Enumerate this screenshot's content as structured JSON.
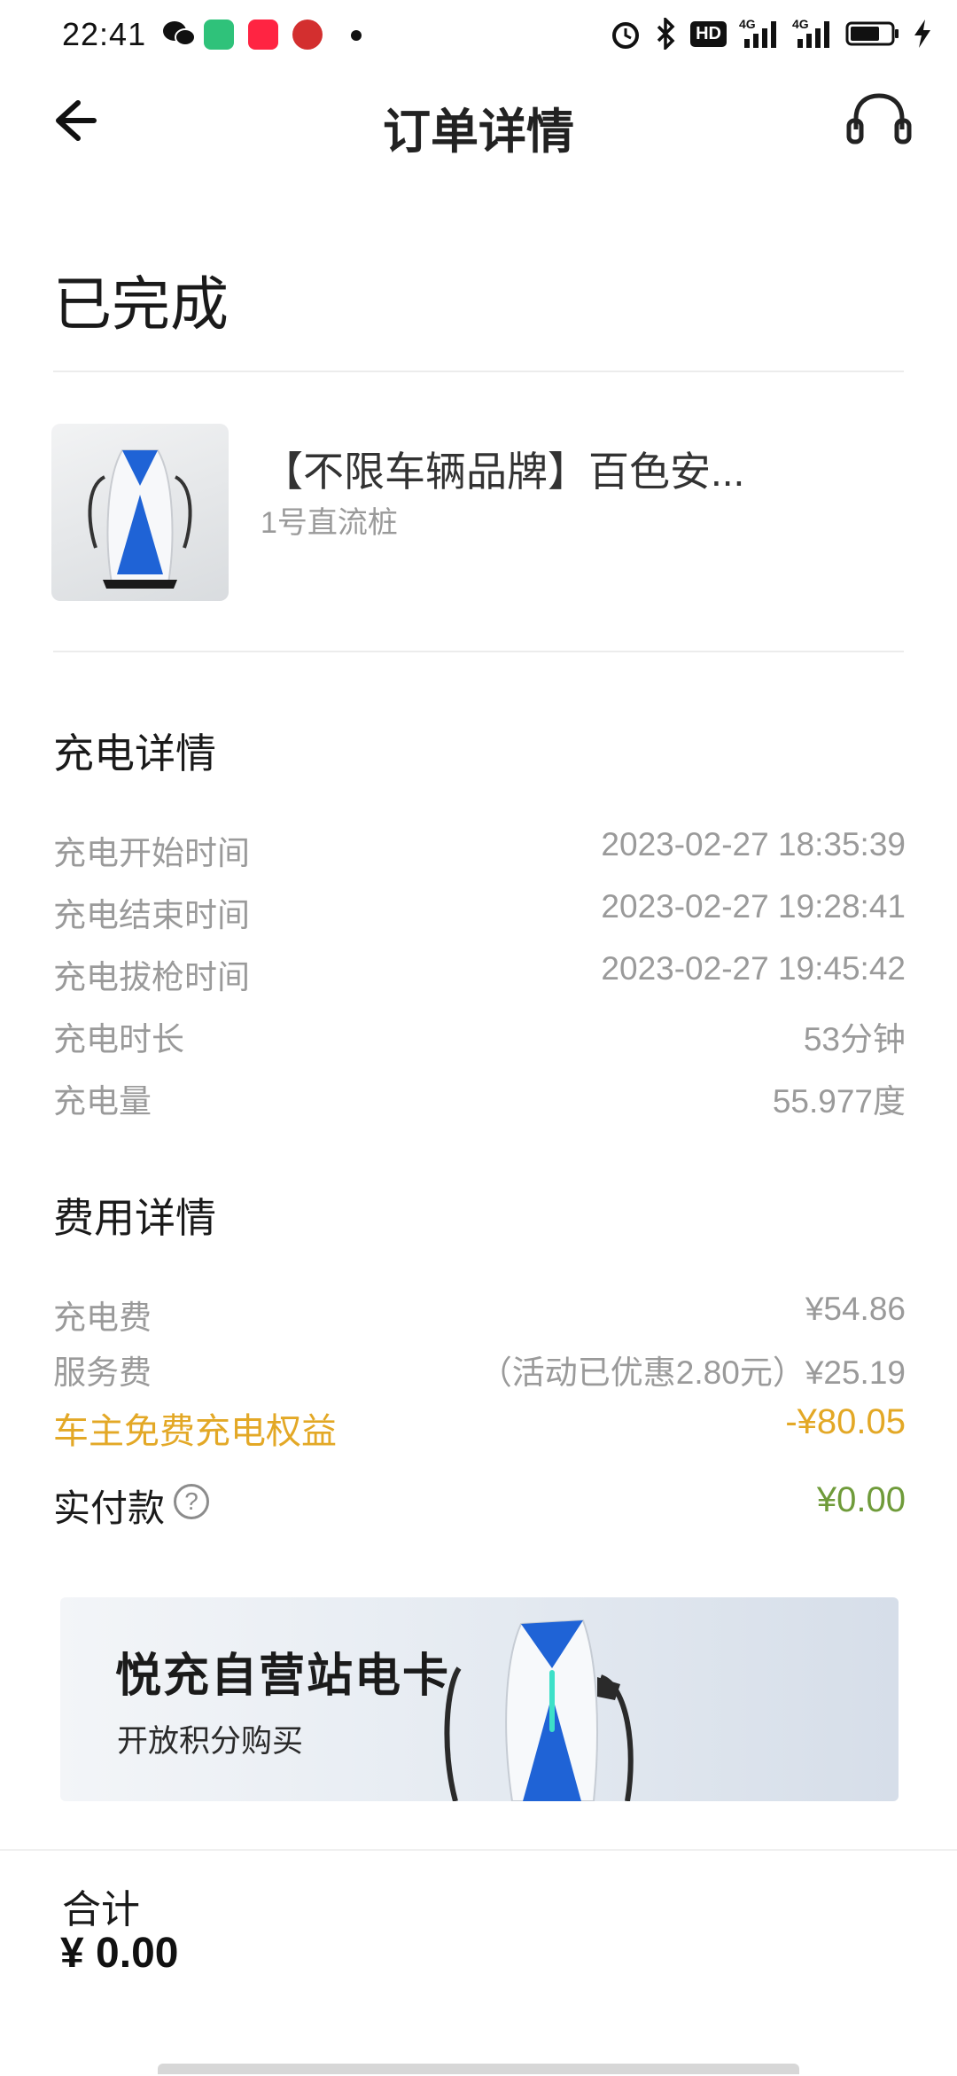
{
  "status_bar": {
    "time": "22:41",
    "hd_label": "HD",
    "net_labels": [
      "4G",
      "4G"
    ],
    "battery_level": 0.72
  },
  "nav": {
    "title": "订单详情"
  },
  "order": {
    "status": "已完成",
    "station_name": "【不限车辆品牌】百色安...",
    "pile_name": "1号直流桩"
  },
  "charge_details": {
    "title": "充电详情",
    "rows": [
      {
        "label": "充电开始时间",
        "value": "2023-02-27 18:35:39"
      },
      {
        "label": "充电结束时间",
        "value": "2023-02-27 19:28:41"
      },
      {
        "label": "充电拔枪时间",
        "value": "2023-02-27 19:45:42"
      },
      {
        "label": "充电时长",
        "value": "53分钟"
      },
      {
        "label": "充电量",
        "value": "55.977度"
      }
    ]
  },
  "fee_details": {
    "title": "费用详情",
    "rows": [
      {
        "label": "充电费",
        "value": "¥54.86"
      },
      {
        "label": "服务费",
        "value": "（活动已优惠2.80元）¥25.19"
      }
    ],
    "benefit": {
      "label": "车主免费充电权益",
      "value": "-¥80.05"
    },
    "paid": {
      "label": "实付款",
      "value": "¥0.00"
    }
  },
  "banner": {
    "title": "悦充自营站电卡",
    "subtitle": "开放积分购买"
  },
  "footer": {
    "total_label": "合计",
    "total_value": "¥ 0.00"
  },
  "colors": {
    "accent_orange": "#e3a826",
    "accent_green": "#6f9b3a",
    "charger_blue": "#1f63d6"
  }
}
